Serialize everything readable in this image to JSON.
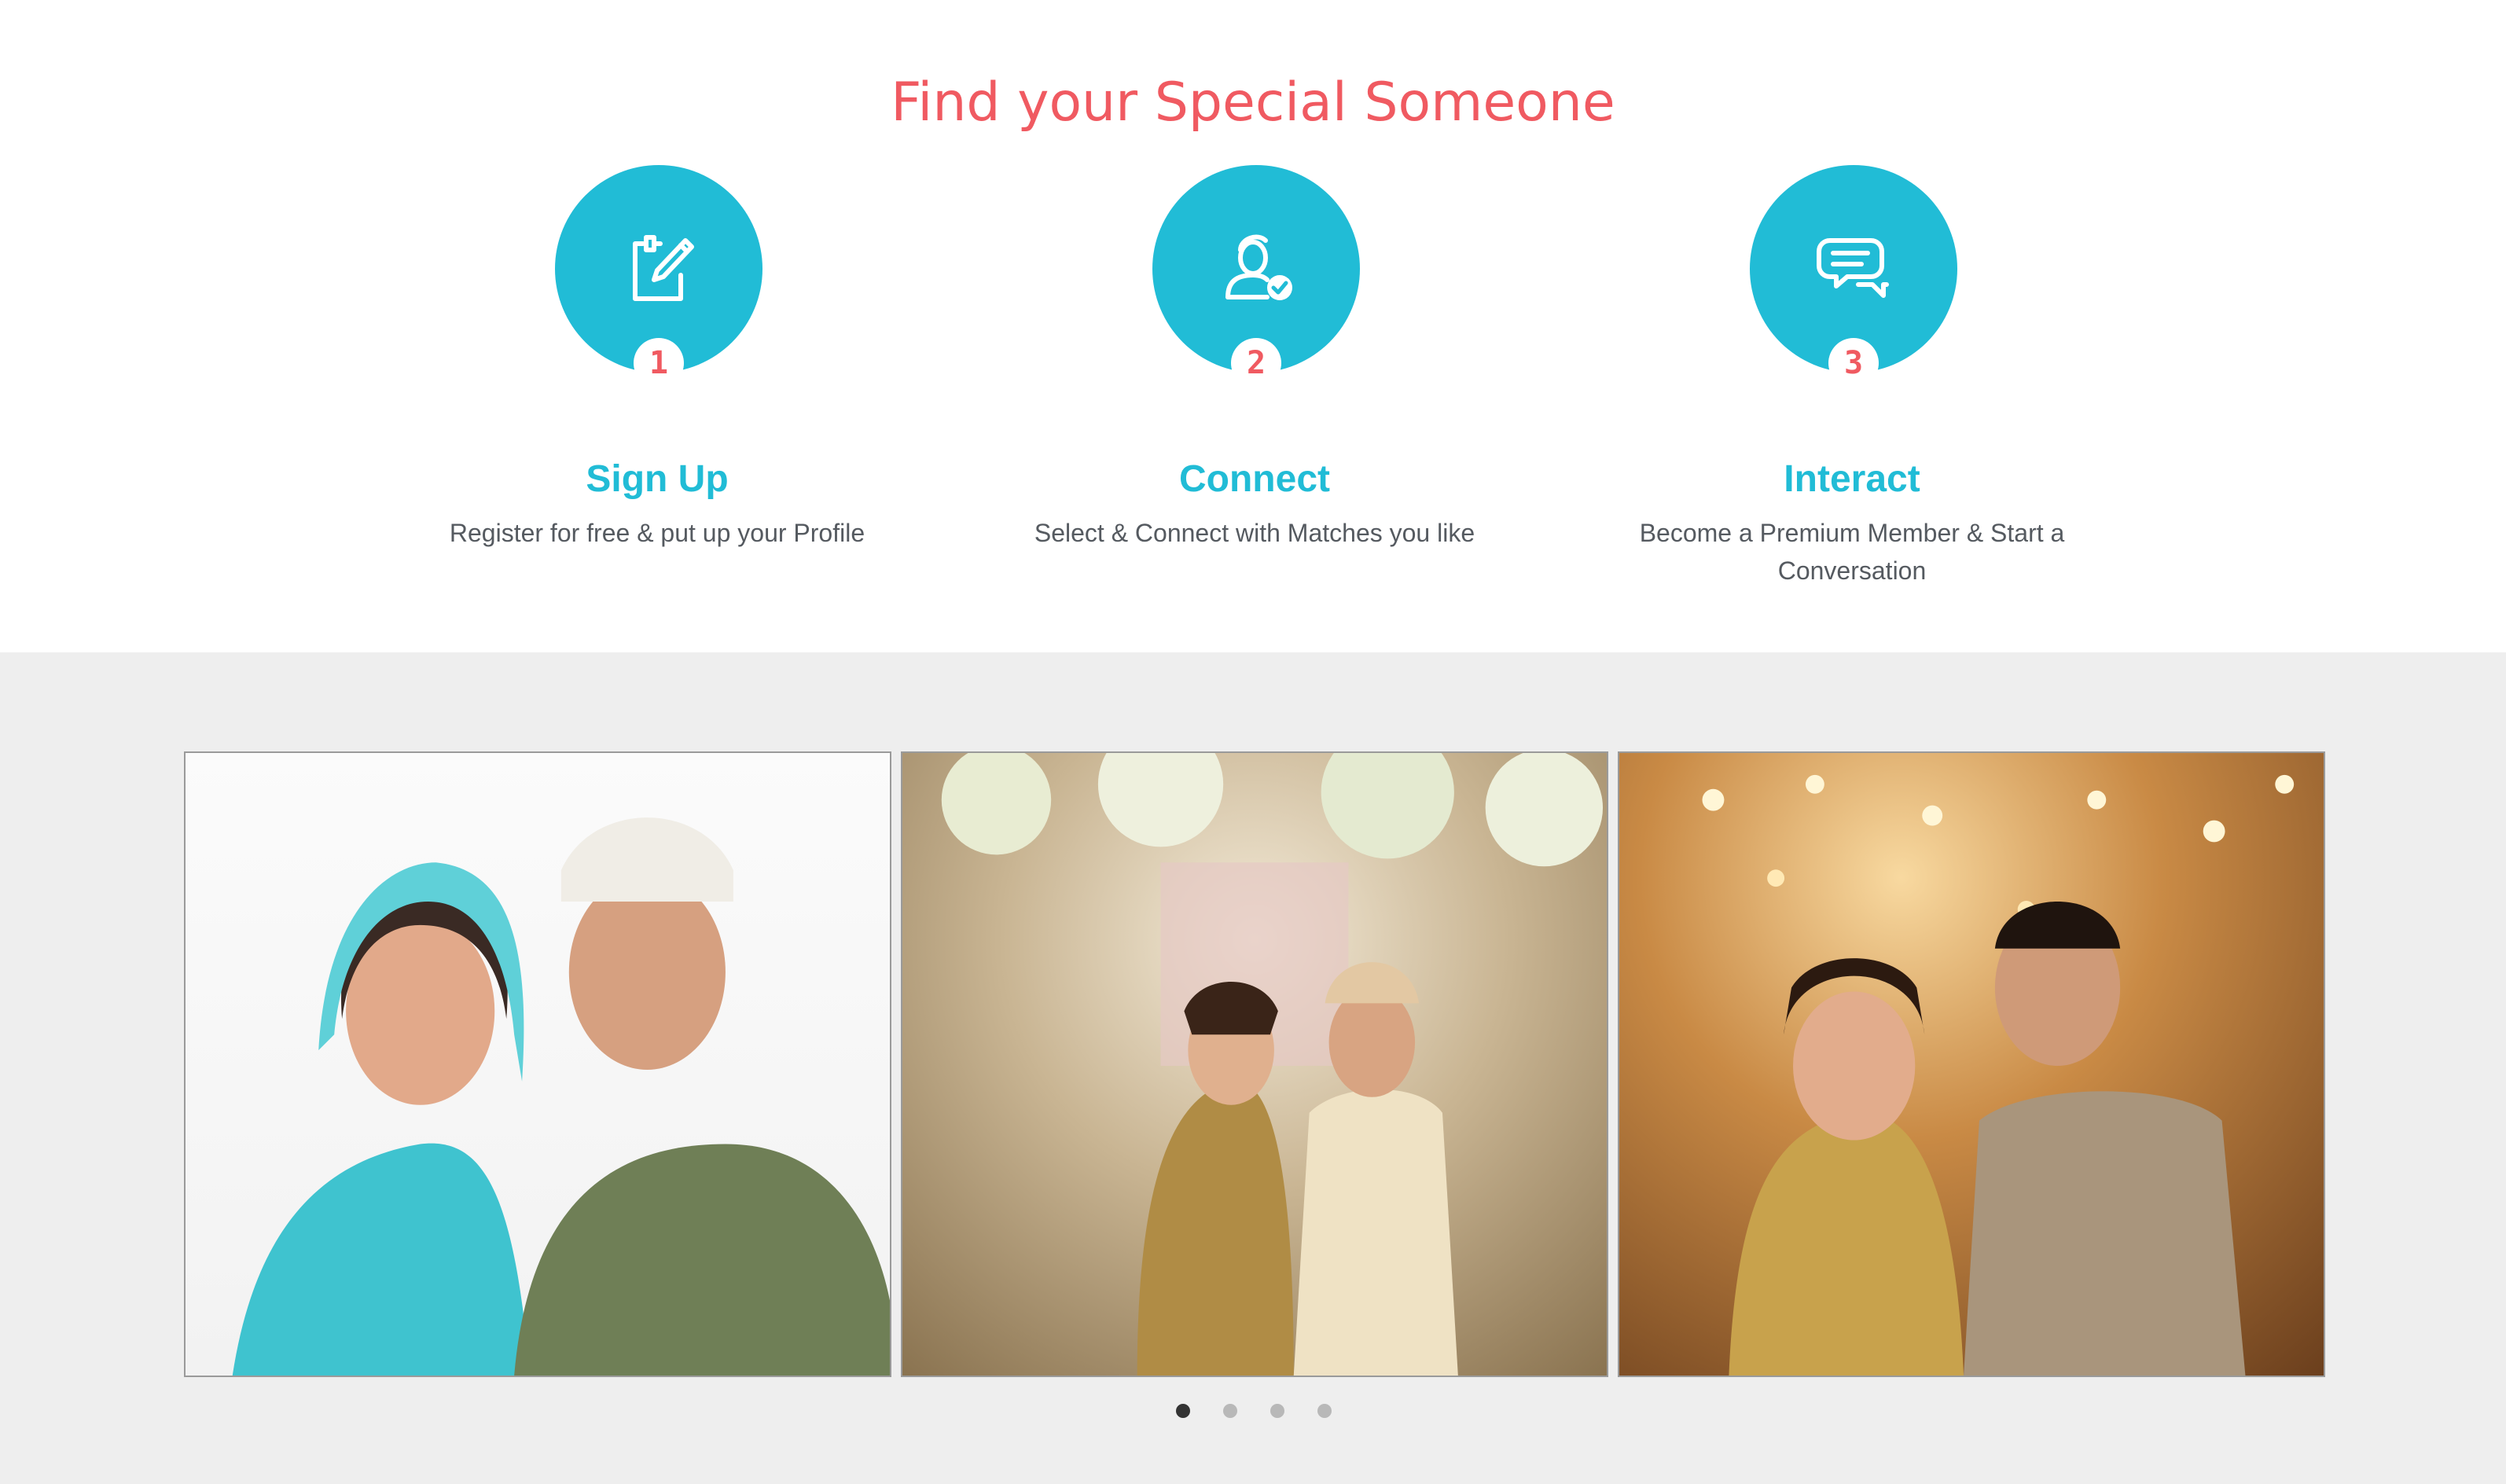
{
  "headline": "Find your Special Someone",
  "steps": [
    {
      "number": "1",
      "title": "Sign Up",
      "description": "Register for free & put up your Profile",
      "icon": "edit-form-icon"
    },
    {
      "number": "2",
      "title": "Connect",
      "description": "Select & Connect with Matches you like",
      "icon": "user-check-icon"
    },
    {
      "number": "3",
      "title": "Interact",
      "description": "Become a Premium Member & Start a Conversation",
      "icon": "chat-bubbles-icon"
    }
  ],
  "colors": {
    "accent_teal": "#21bcd6",
    "accent_coral": "#f05a61",
    "gallery_bg": "#eeeeee"
  },
  "carousel": {
    "slides": [
      "couple-photo-1",
      "couple-photo-2",
      "couple-photo-3"
    ],
    "page_count": 4,
    "active_page": 1
  }
}
